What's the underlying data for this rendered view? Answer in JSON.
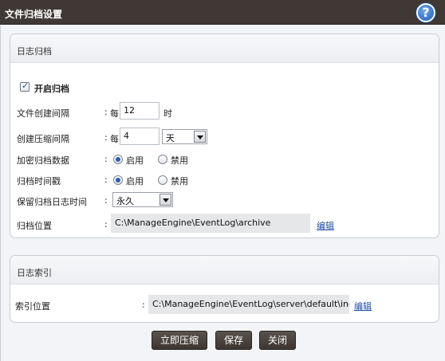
{
  "window": {
    "title": "文件归档设置",
    "help_icon": "?"
  },
  "archive": {
    "section_title": "日志归档",
    "enable_label": "开启归档",
    "enabled": true,
    "create_interval": {
      "label": "文件创建间隔",
      "colon": ":",
      "prefix": "每",
      "value": "12",
      "unit": "时"
    },
    "compress_interval": {
      "label": "创建压缩间隔",
      "colon": ":",
      "prefix": "每",
      "value": "4",
      "unit": "天"
    },
    "encrypt": {
      "label": "加密归档数据",
      "colon": ":",
      "enable": "启用",
      "disable": "禁用",
      "selected": "启用"
    },
    "timestamp": {
      "label": "归档时间戳",
      "colon": ":",
      "enable": "启用",
      "disable": "禁用",
      "selected": "启用"
    },
    "retention": {
      "label": "保留归档日志时间",
      "colon": ":",
      "value": "永久"
    },
    "location": {
      "label": "归档位置",
      "colon": ":",
      "path": "C:\\ManageEngine\\EventLog\\archive",
      "edit": "编辑"
    }
  },
  "index": {
    "section_title": "日志索引",
    "location": {
      "label": "索引位置",
      "colon": ":",
      "path": "C:\\ManageEngine\\EventLog\\server\\default\\index",
      "edit": "编辑"
    }
  },
  "buttons": {
    "compress_now": "立即压缩",
    "save": "保存",
    "close": "关闭"
  }
}
